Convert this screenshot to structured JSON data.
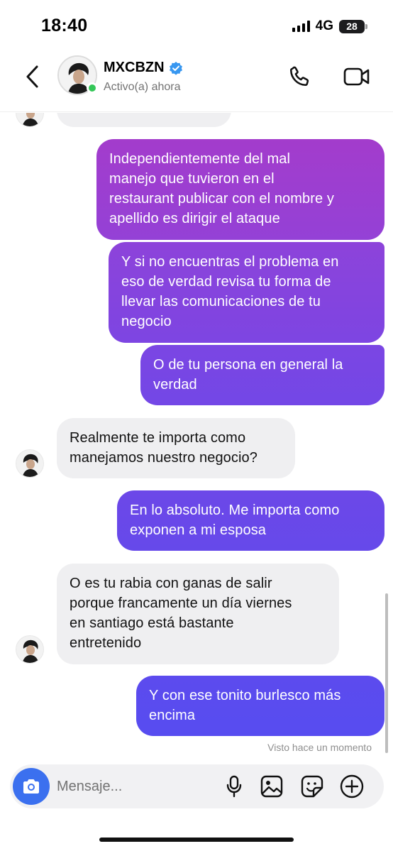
{
  "status_bar": {
    "time": "18:40",
    "network": "4G",
    "battery": "28"
  },
  "header": {
    "name": "MXCBZN",
    "status": "Activo(a) ahora",
    "verified": true
  },
  "messages": [
    {
      "from": "them",
      "text": ""
    },
    {
      "from": "me",
      "lines": [
        "Independientemente del mal",
        "manejo que tuvieron en el",
        "restaurant publicar con el nombre y",
        "apellido es dirigir el ataque"
      ]
    },
    {
      "from": "me",
      "lines": [
        "Y si no encuentras el problema en",
        "eso de verdad revisa tu forma de",
        "llevar las comunicaciones de tu",
        "negocio"
      ]
    },
    {
      "from": "me",
      "lines": [
        "O de tu persona en general la",
        "verdad"
      ]
    },
    {
      "from": "them",
      "lines": [
        "Realmente te importa como",
        "manejamos nuestro negocio?"
      ]
    },
    {
      "from": "me",
      "lines": [
        "En lo absoluto. Me importa como",
        "exponen a mi esposa"
      ]
    },
    {
      "from": "them",
      "lines": [
        "O es tu rabia con ganas de salir",
        "porque francamente un día viernes",
        "en santiago está bastante",
        "entretenido"
      ]
    },
    {
      "from": "me",
      "lines": [
        "Y con ese tonito burlesco más",
        "encima"
      ]
    }
  ],
  "seen_text": "Visto hace un momento",
  "composer": {
    "placeholder": "Mensaje..."
  },
  "colors": {
    "accent_blue": "#3b70ef",
    "verified": "#3897f0",
    "online": "#35c759",
    "bubble_in": "#efeff1",
    "out_gradient": [
      "#a03fcf",
      "#9342d8",
      "#7e45e3",
      "#6e47e8",
      "#5a4bee"
    ]
  },
  "icons": [
    "back-chevron-icon",
    "verified-badge-icon",
    "phone-icon",
    "video-camera-icon",
    "camera-icon",
    "microphone-icon",
    "image-icon",
    "sticker-icon",
    "plus-icon"
  ]
}
